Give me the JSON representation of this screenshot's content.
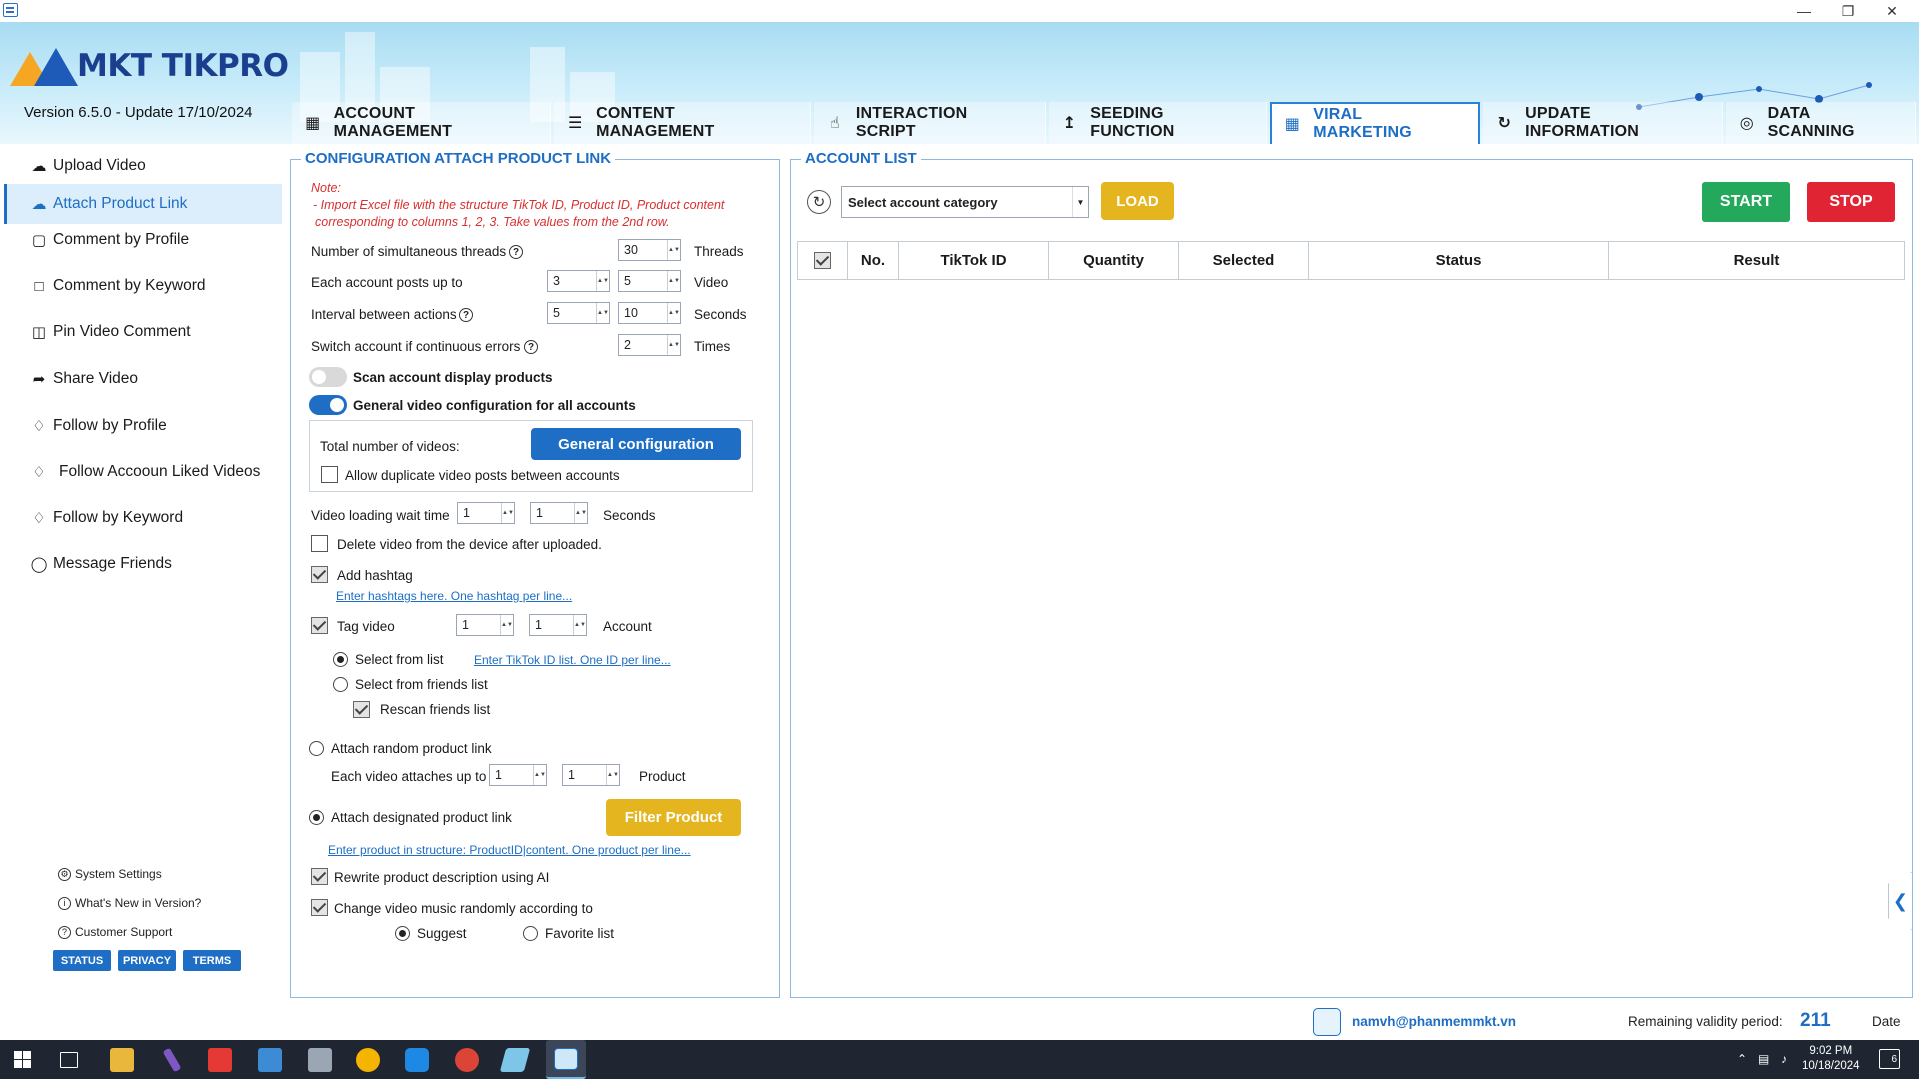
{
  "app": {
    "logo_text": "MKT TIKPRO",
    "version": "Version  6.5.0  - Update  17/10/2024"
  },
  "tabs": [
    {
      "label": "ACCOUNT MANAGEMENT",
      "icon": "calendar-icon"
    },
    {
      "label": "CONTENT MANAGEMENT",
      "icon": "list-icon"
    },
    {
      "label": "INTERACTION SCRIPT",
      "icon": "touch-icon"
    },
    {
      "label": "SEEDING FUNCTION",
      "icon": "upload-box-icon"
    },
    {
      "label": "VIRAL MARKETING",
      "icon": "grid-icon",
      "active": true
    },
    {
      "label": "UPDATE INFORMATION",
      "icon": "refresh-icon"
    },
    {
      "label": "DATA SCANNING",
      "icon": "radar-icon"
    }
  ],
  "sidebar": {
    "items": [
      {
        "label": "Upload Video",
        "icon": "cloud-upload-icon"
      },
      {
        "label": "Attach Product Link",
        "icon": "cloud-link-icon",
        "active": true
      },
      {
        "label": "Comment by Profile",
        "icon": "profile-comment-icon"
      },
      {
        "label": "Comment by Keyword",
        "icon": "comment-icon"
      },
      {
        "label": "Pin Video Comment",
        "icon": "pin-comment-icon"
      },
      {
        "label": "Share Video",
        "icon": "share-icon"
      },
      {
        "label": "Follow by Profile",
        "icon": "bell-icon"
      },
      {
        "label": "Follow Accooun Liked Videos",
        "icon": "bell-icon"
      },
      {
        "label": "Follow by Keyword",
        "icon": "bell-icon"
      },
      {
        "label": "Message Friends",
        "icon": "message-icon"
      }
    ],
    "footer_links": [
      "System Settings",
      "What's New in Version?",
      "Customer Support"
    ],
    "pills": [
      "STATUS",
      "PRIVACY",
      "TERMS"
    ]
  },
  "config": {
    "title": "CONFIGURATION ATTACH PRODUCT LINK",
    "note_label": "Note:",
    "note_text_1": "- Import Excel file with the structure TikTok ID, Product ID, Product content",
    "note_text_2": "corresponding to columns 1, 2, 3. Take values from the 2nd row.",
    "threads": {
      "label": "Number of simultaneous threads",
      "value": "30",
      "unit": "Threads"
    },
    "posts": {
      "label": "Each account posts up to",
      "min": "3",
      "max": "5",
      "unit": "Video"
    },
    "interval": {
      "label": "Interval between actions",
      "min": "5",
      "max": "10",
      "unit": "Seconds"
    },
    "switch": {
      "label": "Switch account if continuous errors",
      "value": "2",
      "unit": "Times"
    },
    "scan_toggle": {
      "label": "Scan account display products",
      "on": false
    },
    "general_toggle": {
      "label": "General video configuration for all accounts",
      "on": true
    },
    "total_videos_label": "Total number of videos:",
    "general_config_button": "General configuration",
    "allow_duplicate": {
      "label": "Allow duplicate video posts between accounts",
      "checked": false
    },
    "loading_wait": {
      "label": "Video loading wait time",
      "min": "1",
      "max": "1",
      "unit": "Seconds"
    },
    "delete_video": {
      "label": "Delete video from the device after uploaded.",
      "checked": false
    },
    "add_hashtag": {
      "label": "Add hashtag",
      "checked": true,
      "link": "Enter hashtags here. One hashtag per line..."
    },
    "tag_video": {
      "label": "Tag video",
      "checked": true,
      "min": "1",
      "max": "1",
      "unit": "Account"
    },
    "select_from_list": {
      "label": "Select from list",
      "selected": true,
      "link": "Enter TikTok ID list. One ID per line..."
    },
    "select_from_friends": {
      "label": "Select from friends list",
      "selected": false
    },
    "rescan_friends": {
      "label": "Rescan friends list",
      "checked": true
    },
    "attach_random": {
      "label": "Attach random product link",
      "selected": false
    },
    "each_video_attaches": {
      "label": "Each video attaches up to",
      "min": "1",
      "max": "1",
      "unit": "Product"
    },
    "attach_designated": {
      "label": "Attach designated product link",
      "selected": true
    },
    "filter_button": "Filter Product",
    "product_link": "Enter product in structure: ProductID|content. One product per line...",
    "rewrite_ai": {
      "label": "Rewrite product description using AI",
      "checked": true
    },
    "change_music": {
      "label": "Change video music randomly according to",
      "checked": true
    },
    "music_suggest": {
      "label": "Suggest",
      "selected": true
    },
    "music_favorite": {
      "label": "Favorite list",
      "selected": false
    }
  },
  "account_list": {
    "title": "ACCOUNT LIST",
    "category_placeholder": "Select account category",
    "load_button": "LOAD",
    "start_button": "START",
    "stop_button": "STOP",
    "columns": [
      "No.",
      "TikTok ID",
      "Quantity",
      "Selected",
      "Status",
      "Result"
    ]
  },
  "status_bar": {
    "email": "namvh@phanmemmkt.vn",
    "remaining_label": "Remaining validity period:",
    "remaining_days": "211",
    "date_label": "Date"
  },
  "taskbar": {
    "time": "9:02 PM",
    "date": "10/18/2024",
    "notifications": "6"
  },
  "colors": {
    "accent": "#1d6ec4",
    "start": "#24a85b",
    "stop": "#e02433",
    "load": "#e5b520",
    "note": "#d83030"
  }
}
